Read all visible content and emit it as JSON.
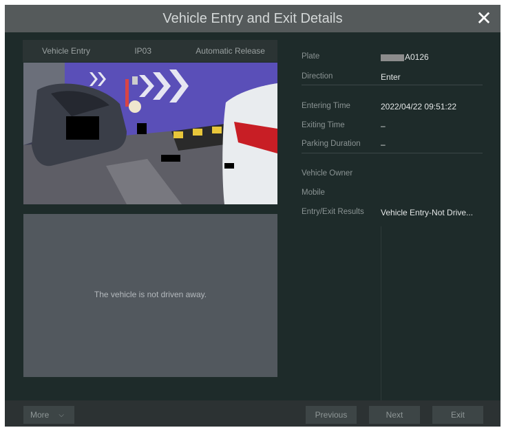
{
  "dialog": {
    "title": "Vehicle Entry and Exit Details",
    "close_icon": "close-icon"
  },
  "camera": {
    "event_type": "Vehicle Entry",
    "channel": "IP03",
    "release_mode": "Automatic Release"
  },
  "exit_panel": {
    "message": "The vehicle is not driven away."
  },
  "info": {
    "plate_label": "Plate",
    "plate_value": "A0126",
    "direction_label": "Direction",
    "direction_value": "Enter",
    "entering_time_label": "Entering Time",
    "entering_time_value": "2022/04/22 09:51:22",
    "exiting_time_label": "Exiting Time",
    "exiting_time_value": "–",
    "parking_duration_label": "Parking Duration",
    "parking_duration_value": "–",
    "vehicle_owner_label": "Vehicle Owner",
    "mobile_label": "Mobile",
    "results_label": "Entry/Exit Results",
    "results_value": "Vehicle Entry-Not Drive..."
  },
  "footer": {
    "more_label": "More",
    "more_icon": "chevron-down-icon",
    "previous_label": "Previous",
    "next_label": "Next",
    "exit_label": "Exit"
  }
}
